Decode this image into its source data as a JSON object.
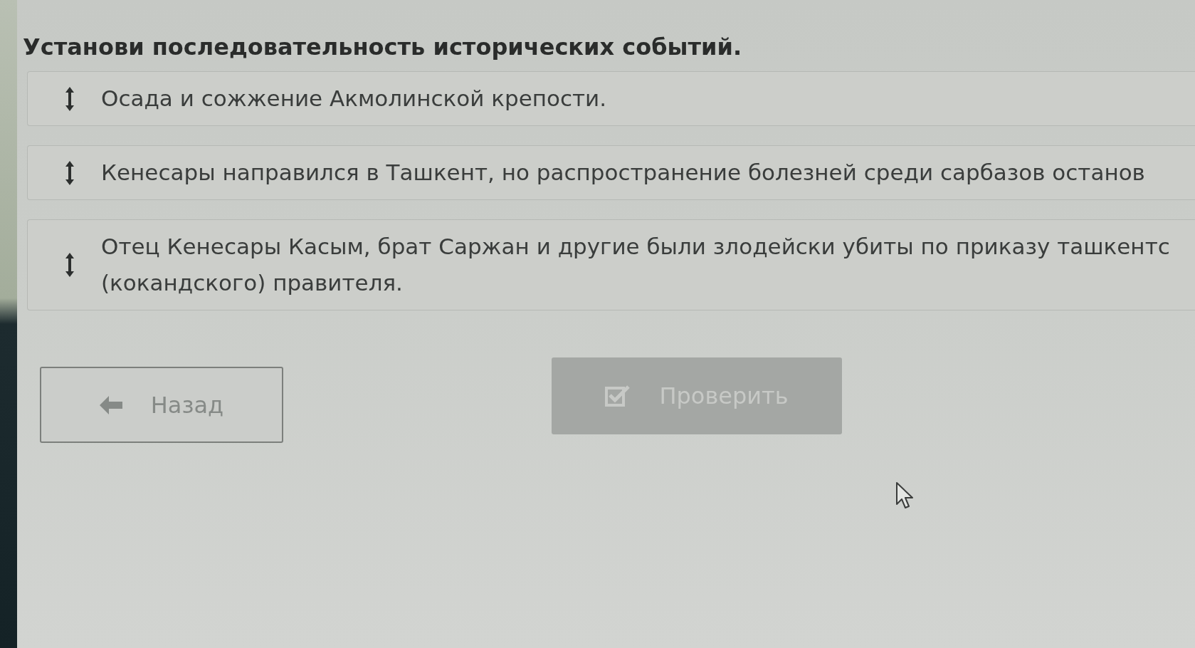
{
  "question": {
    "title": "Установи последовательность исторических событий."
  },
  "items": [
    {
      "lines": [
        "Осада и сожжение Акмолинской крепости."
      ]
    },
    {
      "lines": [
        "Кенесары направился в Ташкент, но распространение болезней среди сарбазов останов"
      ]
    },
    {
      "lines": [
        "Отец Кенесары Касым, брат Саржан и другие были злодейски убиты по приказу ташкентс",
        "(кокандского) правителя."
      ]
    }
  ],
  "buttons": [
    {
      "kind": "back",
      "label": "Назад",
      "disabled": false
    },
    {
      "kind": "check",
      "label": "Проверить",
      "disabled": true
    }
  ]
}
